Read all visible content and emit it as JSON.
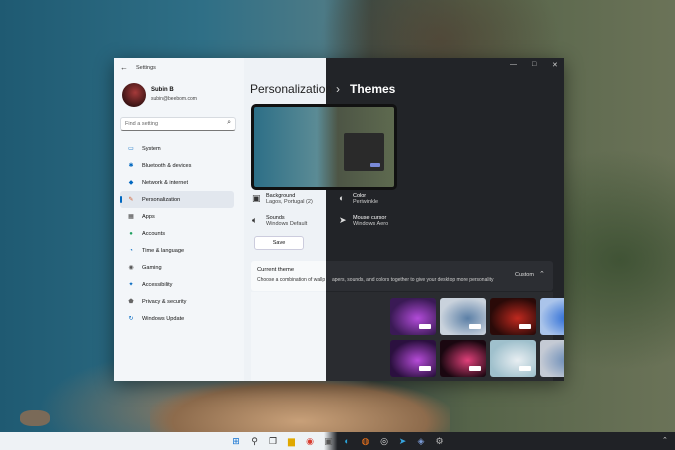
{
  "window": {
    "title": "Settings",
    "controls": [
      "—",
      "□",
      "✕"
    ]
  },
  "user": {
    "name": "Subin B",
    "email": "subin@beebom.com"
  },
  "search": {
    "placeholder": "Find a setting"
  },
  "sidebar": {
    "items": [
      {
        "label": "System",
        "icon": "monitor-icon",
        "color": "#0067c0"
      },
      {
        "label": "Bluetooth & devices",
        "icon": "bluetooth-icon",
        "color": "#0067c0"
      },
      {
        "label": "Network & internet",
        "icon": "wifi-icon",
        "color": "#0067c0"
      },
      {
        "label": "Personalization",
        "icon": "brush-icon",
        "color": "#d35c2c",
        "active": true
      },
      {
        "label": "Apps",
        "icon": "apps-icon",
        "color": "#444"
      },
      {
        "label": "Accounts",
        "icon": "person-icon",
        "color": "#20a060"
      },
      {
        "label": "Time & language",
        "icon": "globe-clock-icon",
        "color": "#0067c0"
      },
      {
        "label": "Gaming",
        "icon": "gamepad-icon",
        "color": "#555"
      },
      {
        "label": "Accessibility",
        "icon": "accessibility-icon",
        "color": "#0067c0"
      },
      {
        "label": "Privacy & security",
        "icon": "shield-icon",
        "color": "#666"
      },
      {
        "label": "Windows Update",
        "icon": "update-icon",
        "color": "#0067c0"
      }
    ]
  },
  "breadcrumb": {
    "parent": "Personalization",
    "separator": "›",
    "current": "Themes"
  },
  "props": {
    "background": {
      "title": "Background",
      "value": "Lagos, Portugal (2)"
    },
    "sounds": {
      "title": "Sounds",
      "value": "Windows Default"
    },
    "color": {
      "title": "Color",
      "value": "Periwinkle"
    },
    "cursor": {
      "title": "Mouse cursor",
      "value": "Windows Aero"
    },
    "save_label": "Save"
  },
  "current_theme": {
    "title": "Current theme",
    "description_light": "Choose a combination of wallp",
    "description_dark": "apers, sounds, and colors together to give your desktop more personality",
    "custom_label": "Custom",
    "chevron": "⌃"
  },
  "themes": [
    {
      "name": "theme-purple-dark",
      "bg": "#3a1a55",
      "accent": "#b24bd9"
    },
    {
      "name": "theme-flow-light",
      "bg": "#c9d2dc",
      "accent": "#5b7fa6"
    },
    {
      "name": "theme-red-dark",
      "bg": "#2a0a08",
      "accent": "#c0291f"
    },
    {
      "name": "theme-bloom-light",
      "bg": "#aac4ea",
      "accent": "#2a6bd6"
    },
    {
      "name": "theme-bloom-dark",
      "bg": "#0a1a4a",
      "accent": "#2f66ff"
    },
    {
      "name": "theme-purple-dark-2",
      "bg": "#2b103f",
      "accent": "#b64bd8"
    },
    {
      "name": "theme-flower-dark",
      "bg": "#1a0710",
      "accent": "#e0407a"
    },
    {
      "name": "theme-lake-light",
      "bg": "#9fc0cc",
      "accent": "#e8eef2"
    },
    {
      "name": "theme-flow-light-2",
      "bg": "#c4cad4",
      "accent": "#6a8cb8"
    }
  ],
  "taskbar": {
    "icons": [
      {
        "name": "windows-start-icon",
        "glyph": "⊞",
        "color": "#0a6ed1"
      },
      {
        "name": "search-icon",
        "glyph": "⚲",
        "color": "#333"
      },
      {
        "name": "task-view-icon",
        "glyph": "❐",
        "color": "#333"
      },
      {
        "name": "file-explorer-icon",
        "glyph": "▆",
        "color": "#e0a800"
      },
      {
        "name": "chrome-icon",
        "glyph": "◉",
        "color": "#d93b2f"
      },
      {
        "name": "store-icon",
        "glyph": "▣",
        "color": "#555"
      },
      {
        "name": "edge-icon",
        "glyph": "◐",
        "color": "#2aa4d9"
      },
      {
        "name": "firefox-icon",
        "glyph": "◍",
        "color": "#ff7a1a"
      },
      {
        "name": "steam-icon",
        "glyph": "◎",
        "color": "#ddd"
      },
      {
        "name": "telegram-icon",
        "glyph": "➤",
        "color": "#37a5e0"
      },
      {
        "name": "app-icon",
        "glyph": "◈",
        "color": "#7b9bd6"
      },
      {
        "name": "settings-icon",
        "glyph": "⚙",
        "color": "#bbb"
      }
    ],
    "overflow": "⌃"
  }
}
